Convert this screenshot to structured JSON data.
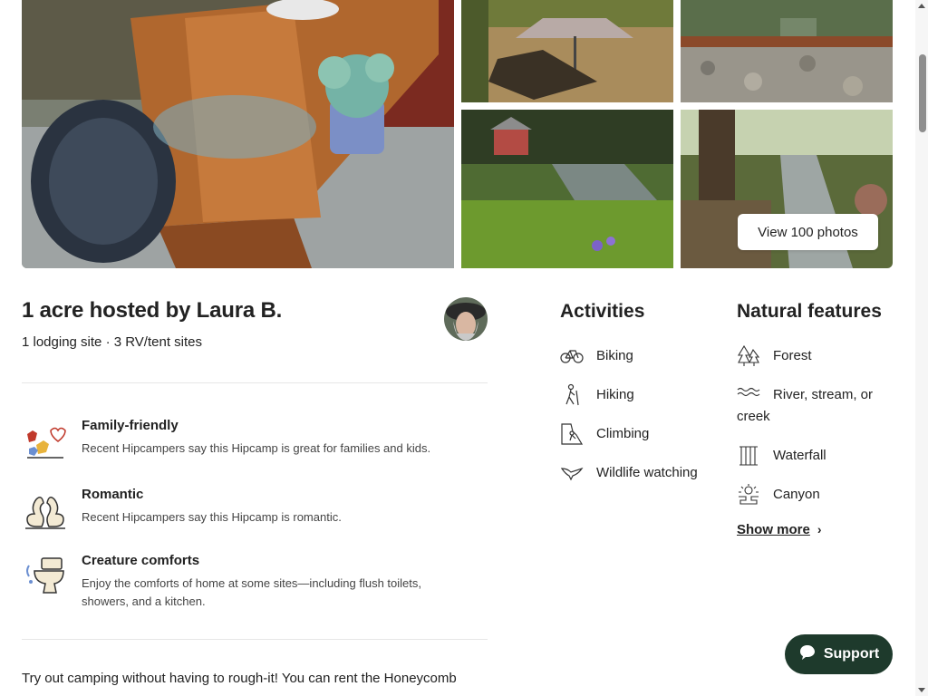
{
  "gallery": {
    "view_photos_label": "View 100 photos",
    "photos": [
      "main-table-photo",
      "umbrella-photo",
      "stone-wall-photo",
      "creek-cabin-photo",
      "creek-photo"
    ]
  },
  "host": {
    "title": "1 acre hosted by Laura B.",
    "subtitle": "1 lodging site · 3 RV/tent sites"
  },
  "features": [
    {
      "icon": "birds-icon",
      "title": "Family-friendly",
      "description": "Recent Hipcampers say this Hipcamp is great for families and kids."
    },
    {
      "icon": "swans-icon",
      "title": "Romantic",
      "description": "Recent Hipcampers say this Hipcamp is romantic."
    },
    {
      "icon": "toilet-icon",
      "title": "Creature comforts",
      "description": "Enjoy the comforts of home at some sites—including flush toilets, showers, and a kitchen."
    }
  ],
  "description_start": "Try out camping without having to rough-it! You can rent the Honeycomb",
  "activities": {
    "title": "Activities",
    "items": [
      {
        "icon": "bike-icon",
        "label": "Biking"
      },
      {
        "icon": "hiker-icon",
        "label": "Hiking"
      },
      {
        "icon": "climbing-icon",
        "label": "Climbing"
      },
      {
        "icon": "bird-icon",
        "label": "Wildlife watching"
      }
    ]
  },
  "natural_features": {
    "title": "Natural features",
    "items": [
      {
        "icon": "forest-icon",
        "label": "Forest"
      },
      {
        "icon": "waves-icon",
        "label": "River, stream, or creek"
      },
      {
        "icon": "waterfall-icon",
        "label": "Waterfall"
      },
      {
        "icon": "canyon-icon",
        "label": "Canyon"
      }
    ],
    "show_more_label": "Show more"
  },
  "support_label": "Support",
  "colors": {
    "support_bg": "#1e3a2c",
    "text": "#222222"
  }
}
